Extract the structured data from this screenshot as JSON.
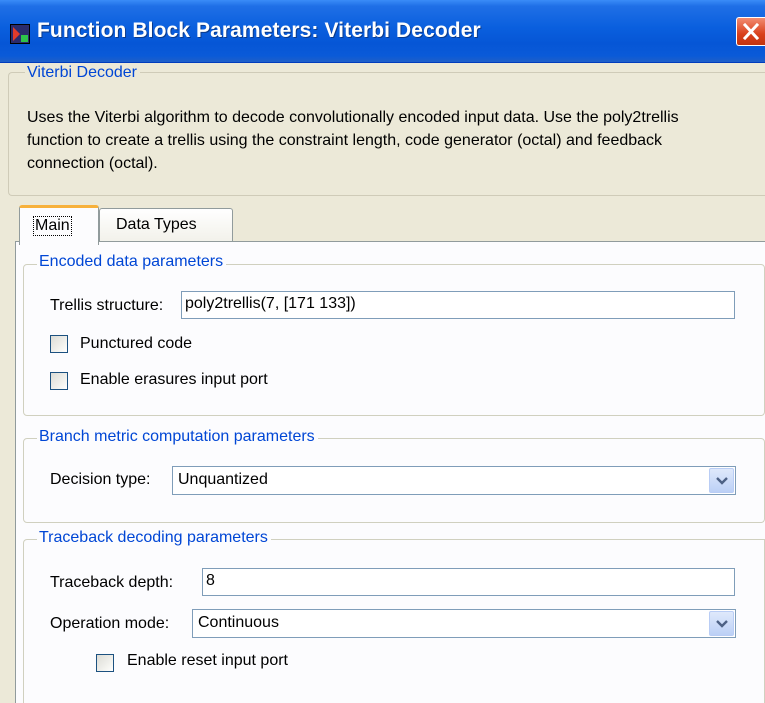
{
  "window": {
    "title": "Function Block Parameters: Viterbi Decoder"
  },
  "description": {
    "group_title": "Viterbi Decoder",
    "text": "Uses the Viterbi algorithm to decode convolutionally encoded input data.  Use the poly2trellis function to create a trellis using the constraint length, code generator (octal) and feedback connection (octal)."
  },
  "tabs": [
    {
      "label": "Main",
      "selected": true
    },
    {
      "label": "Data Types",
      "selected": false
    }
  ],
  "encoded": {
    "group_title": "Encoded data parameters",
    "trellis_label": "Trellis structure:",
    "trellis_value": "poly2trellis(7, [171 133])",
    "punctured_label": "Punctured code",
    "punctured_checked": false,
    "erasures_label": "Enable erasures input port",
    "erasures_checked": false
  },
  "branch": {
    "group_title": "Branch metric computation parameters",
    "decision_label": "Decision type:",
    "decision_value": "Unquantized"
  },
  "traceback": {
    "group_title": "Traceback decoding parameters",
    "depth_label": "Traceback depth:",
    "depth_value": "8",
    "mode_label": "Operation mode:",
    "mode_value": "Continuous",
    "reset_label": "Enable reset input port",
    "reset_checked": false
  },
  "colors": {
    "titlebar": "#0a5fde",
    "group_title": "#0046d5",
    "dialog_bg": "#ece9d8"
  }
}
